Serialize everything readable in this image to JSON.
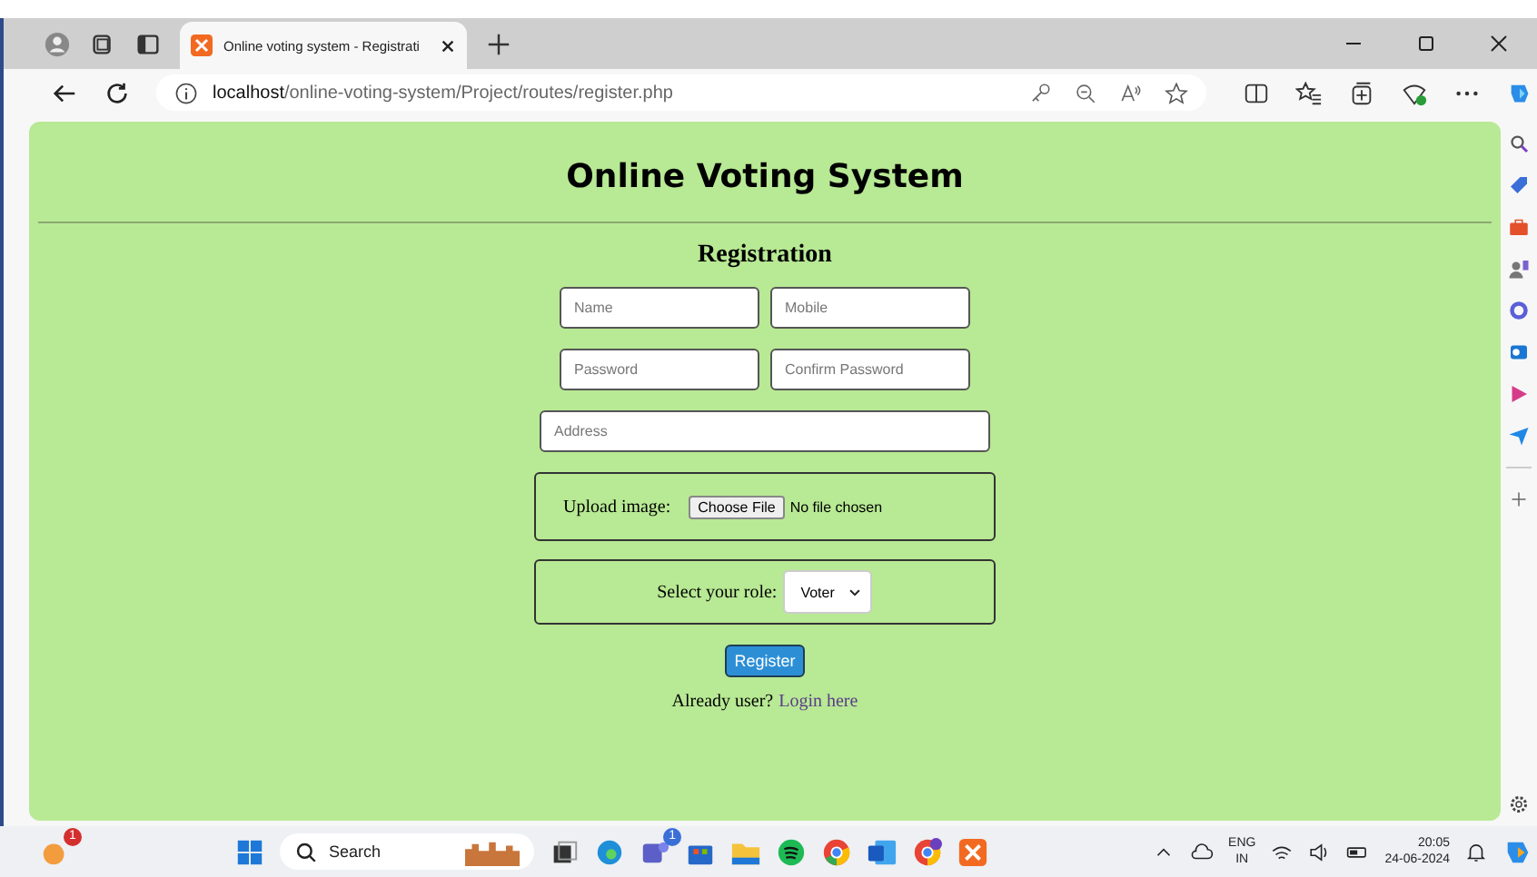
{
  "browser": {
    "tab": {
      "title": "Online voting system - Registrati",
      "selected": true
    },
    "url_host": "localhost",
    "url_path": "/online-voting-system/Project/routes/register.php"
  },
  "page": {
    "title": "Online Voting System",
    "form_title": "Registration",
    "fields": [
      {
        "placeholder": "Name"
      },
      {
        "placeholder": "Mobile"
      },
      {
        "placeholder": "Password"
      },
      {
        "placeholder": "Confirm Password"
      }
    ],
    "address": {
      "placeholder": "Address"
    },
    "upload": {
      "label": "Upload image:",
      "button": "Choose File",
      "status": "No file chosen"
    },
    "role": {
      "label": "Select your role:",
      "value": "Voter"
    },
    "register": "Register",
    "login_prompt": "Already user?",
    "login_link": "Login here"
  },
  "taskbar": {
    "search": "Search",
    "badge": "1",
    "teams_badge": "1",
    "language": "ENG",
    "region": "IN",
    "time": "20:05",
    "date": "24-06-2024"
  }
}
